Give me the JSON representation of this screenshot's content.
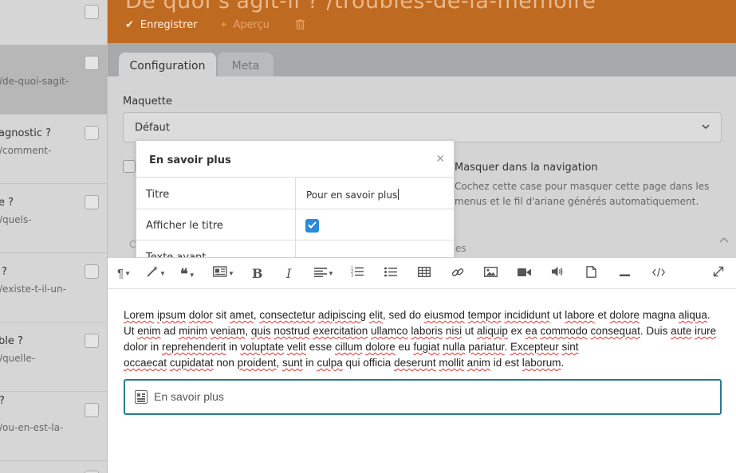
{
  "header": {
    "page_title": "De quoi s'agit-il ?             /troubles-de-la-memoire",
    "save_label": "Enregistrer",
    "preview_label": "Aperçu",
    "save_icon": "check-icon",
    "preview_icon": "crosshair-icon",
    "delete_icon": "trash-icon",
    "accent_color": "#bf6a21"
  },
  "sidebar": {
    "items": [
      {
        "title": "",
        "slug": ""
      },
      {
        "title": "",
        "slug": "/de-quoi-sagit-"
      },
      {
        "title": "agnostic ?",
        "slug": "/comment-"
      },
      {
        "title": "e ?",
        "slug": "/quels-"
      },
      {
        "title": "?",
        "slug": "/existe-t-il-un-"
      },
      {
        "title": "ble ?",
        "slug": "/quelle-"
      },
      {
        "title": "?",
        "slug": "/ou-en-est-la-"
      },
      {
        "title": "",
        "slug": ""
      }
    ]
  },
  "tabs": [
    {
      "label": "Configuration",
      "active": true
    },
    {
      "label": "Meta",
      "active": false
    }
  ],
  "form": {
    "layout_label": "Maquette",
    "layout_value": "Défaut",
    "hide_nav_label": "Masquer dans la navigation",
    "hide_nav_help": "Cochez cette case pour masquer cette page dans les menus et le fil d'ariane générés automatiquement.",
    "obscured_fragment": "es",
    "obscured_left_fragment": "C"
  },
  "modal": {
    "title": "En savoir plus",
    "close_glyph": "×",
    "rows": {
      "titre_label": "Titre",
      "titre_value": "Pour en savoir plus",
      "show_title_label": "Afficher le titre",
      "show_title_checked": true,
      "texte_avant_label": "Texte avant"
    }
  },
  "toolbar": {
    "icons": [
      "paragraph-icon",
      "magic-wand-icon",
      "quote-icon",
      "insert-block-icon",
      "bold-icon",
      "italic-icon",
      "align-icon",
      "ordered-list-icon",
      "unordered-list-icon",
      "table-icon",
      "link-icon",
      "image-icon",
      "video-icon",
      "audio-icon",
      "file-icon",
      "horizontal-rule-icon",
      "code-icon",
      "fullscreen-icon"
    ],
    "bold_glyph": "B",
    "italic_glyph": "I"
  },
  "editor": {
    "snippet_label": "En savoir plus",
    "snippet_icon": "news-icon",
    "snippet_border_color": "#2a7a8f"
  }
}
